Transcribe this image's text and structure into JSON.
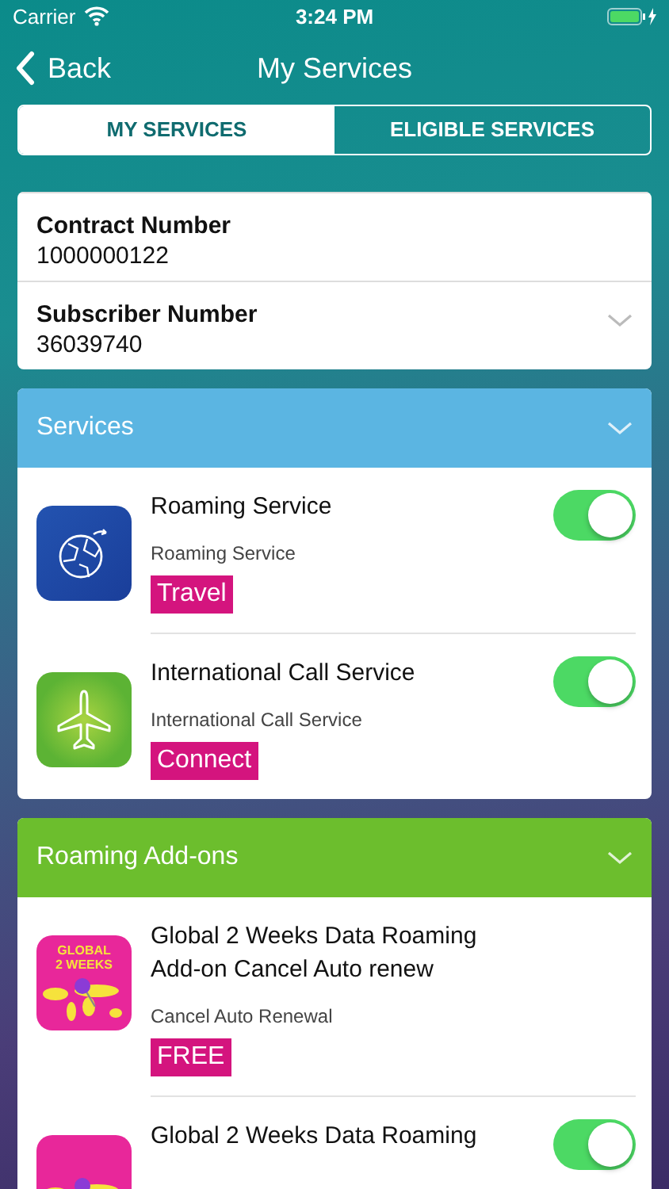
{
  "status_bar": {
    "carrier": "Carrier",
    "time": "3:24 PM"
  },
  "nav": {
    "back": "Back",
    "title": "My Services"
  },
  "tabs": [
    {
      "label": "MY SERVICES",
      "selected": true
    },
    {
      "label": "ELIGIBLE SERVICES",
      "selected": false
    }
  ],
  "account": {
    "fields": [
      {
        "label": "Contract Number",
        "value": "1000000122"
      },
      {
        "label": "Subscriber Number",
        "value": "36039740"
      }
    ]
  },
  "sections": [
    {
      "title": "Services",
      "color": "#5bb5e2",
      "expanded": true,
      "items": [
        {
          "kind": "globe",
          "title": "Roaming Service",
          "subtitle": "Roaming Service",
          "tag": "Travel",
          "on": true
        },
        {
          "kind": "plane",
          "title": "International Call Service",
          "subtitle": "International Call Service",
          "tag": "Connect",
          "on": true
        }
      ]
    },
    {
      "title": "Roaming Add-ons",
      "color": "#6cbe2d",
      "expanded": true,
      "items": [
        {
          "kind": "map",
          "icon_text": "GLOBAL 2 WEEKS",
          "title": "Global 2 Weeks Data Roaming Add-on Cancel Auto renew",
          "subtitle": "Cancel Auto Renewal",
          "tag": "FREE"
        },
        {
          "kind": "map",
          "title": "Global 2 Weeks Data Roaming",
          "on": true
        }
      ]
    }
  ]
}
